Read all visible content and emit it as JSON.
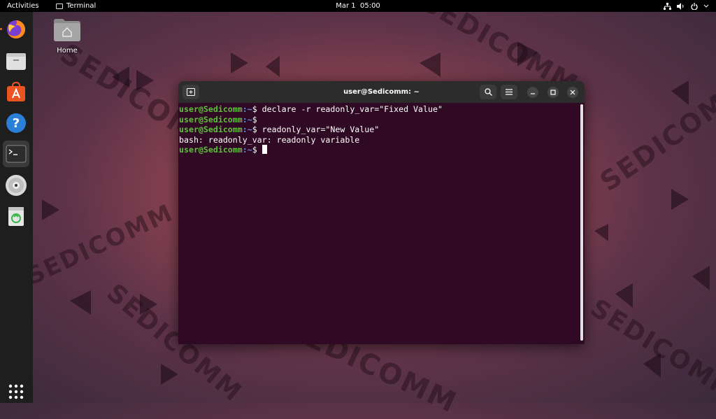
{
  "topbar": {
    "activities": "Activities",
    "app_name": "Terminal",
    "clock": "Mar 1  05:00",
    "tray_icons": [
      "network-icon",
      "volume-icon",
      "power-icon"
    ]
  },
  "dock": {
    "items": [
      {
        "name": "firefox",
        "icon": "firefox-icon"
      },
      {
        "name": "files",
        "icon": "files-icon"
      },
      {
        "name": "software",
        "icon": "software-icon"
      },
      {
        "name": "help",
        "icon": "help-icon"
      },
      {
        "name": "terminal",
        "icon": "terminal-icon",
        "active": true
      },
      {
        "name": "disc",
        "icon": "disc-icon"
      },
      {
        "name": "trash",
        "icon": "trash-icon"
      },
      {
        "name": "show-apps",
        "icon": "app-grid-icon"
      }
    ]
  },
  "desktop": {
    "home_label": "Home"
  },
  "watermark_text": "SEDICOMM",
  "terminal": {
    "title": "user@Sedicomm: ~",
    "lines": [
      {
        "user": "user@Sedicomm",
        "path": ":~",
        "cmd": "$ declare -r readonly_var=\"Fixed Value\""
      },
      {
        "user": "user@Sedicomm",
        "path": ":~",
        "cmd": "$"
      },
      {
        "user": "user@Sedicomm",
        "path": ":~",
        "cmd": "$ readonly_var=\"New Value\""
      },
      {
        "output": "bash: readonly_var: readonly variable"
      },
      {
        "user": "user@Sedicomm",
        "path": ":~",
        "cmd": "$ "
      }
    ]
  },
  "colors": {
    "terminal_bg": "#300a24",
    "prompt_user": "#5fbf3a",
    "prompt_path": "#5f8fd8",
    "headerbar": "#2c2c2c"
  }
}
